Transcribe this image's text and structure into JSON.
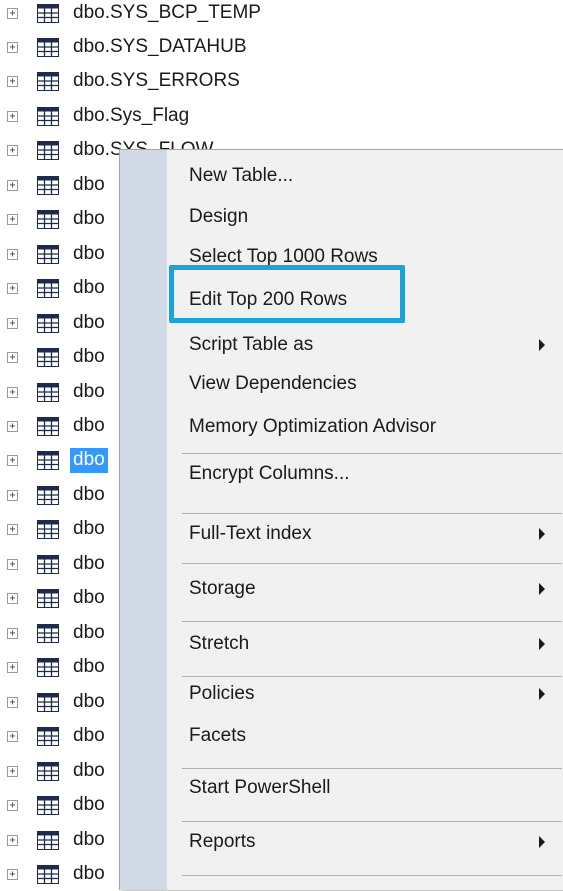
{
  "tree": {
    "rows": [
      {
        "label": "dbo.SYS_BCP_TEMP",
        "selected": false
      },
      {
        "label": "dbo.SYS_DATAHUB",
        "selected": false
      },
      {
        "label": "dbo.SYS_ERRORS",
        "selected": false
      },
      {
        "label": "dbo.Sys_Flag",
        "selected": false
      },
      {
        "label": "dbo.SYS_FLOW",
        "selected": false
      },
      {
        "label": "dbo",
        "selected": false
      },
      {
        "label": "dbo",
        "selected": false
      },
      {
        "label": "dbo",
        "selected": false
      },
      {
        "label": "dbo",
        "selected": false
      },
      {
        "label": "dbo",
        "selected": false
      },
      {
        "label": "dbo",
        "selected": false
      },
      {
        "label": "dbo",
        "selected": false
      },
      {
        "label": "dbo",
        "selected": false
      },
      {
        "label": "dbo",
        "selected": true
      },
      {
        "label": "dbo",
        "selected": false
      },
      {
        "label": "dbo",
        "selected": false
      },
      {
        "label": "dbo",
        "selected": false
      },
      {
        "label": "dbo",
        "selected": false
      },
      {
        "label": "dbo",
        "selected": false
      },
      {
        "label": "dbo",
        "selected": false
      },
      {
        "label": "dbo",
        "selected": false
      },
      {
        "label": "dbo",
        "selected": false
      },
      {
        "label": "dbo",
        "selected": false
      },
      {
        "label": "dbo",
        "selected": false
      },
      {
        "label": "dbo",
        "selected": false
      },
      {
        "label": "dbo",
        "selected": false
      }
    ],
    "expander_glyph": "+",
    "icon": "table-icon"
  },
  "context_menu": {
    "items": [
      {
        "label": "New Table...",
        "submenu": false
      },
      {
        "label": "Design",
        "submenu": false
      },
      {
        "label": "Select Top 1000 Rows",
        "submenu": false
      },
      {
        "label": "Edit Top 200 Rows",
        "submenu": false,
        "highlighted": true
      },
      {
        "label": "Script Table as",
        "submenu": true
      },
      {
        "label": "View Dependencies",
        "submenu": false
      },
      {
        "label": "Memory Optimization Advisor",
        "submenu": false,
        "separator_after": true
      },
      {
        "label": "Encrypt Columns...",
        "submenu": false,
        "separator_after": true
      },
      {
        "label": "Full-Text index",
        "submenu": true,
        "separator_after": true
      },
      {
        "label": "Storage",
        "submenu": true,
        "separator_after": true
      },
      {
        "label": "Stretch",
        "submenu": true,
        "separator_after": true
      },
      {
        "label": "Policies",
        "submenu": true
      },
      {
        "label": "Facets",
        "submenu": false,
        "separator_after": true
      },
      {
        "label": "Start PowerShell",
        "submenu": false,
        "separator_after": true
      },
      {
        "label": "Reports",
        "submenu": true,
        "separator_after": true
      }
    ]
  },
  "colors": {
    "selection": "#3399ff",
    "highlight_box": "#1aa2dc",
    "menu_bg": "#f1f1f1",
    "menu_gutter": "#d2d9e6"
  }
}
